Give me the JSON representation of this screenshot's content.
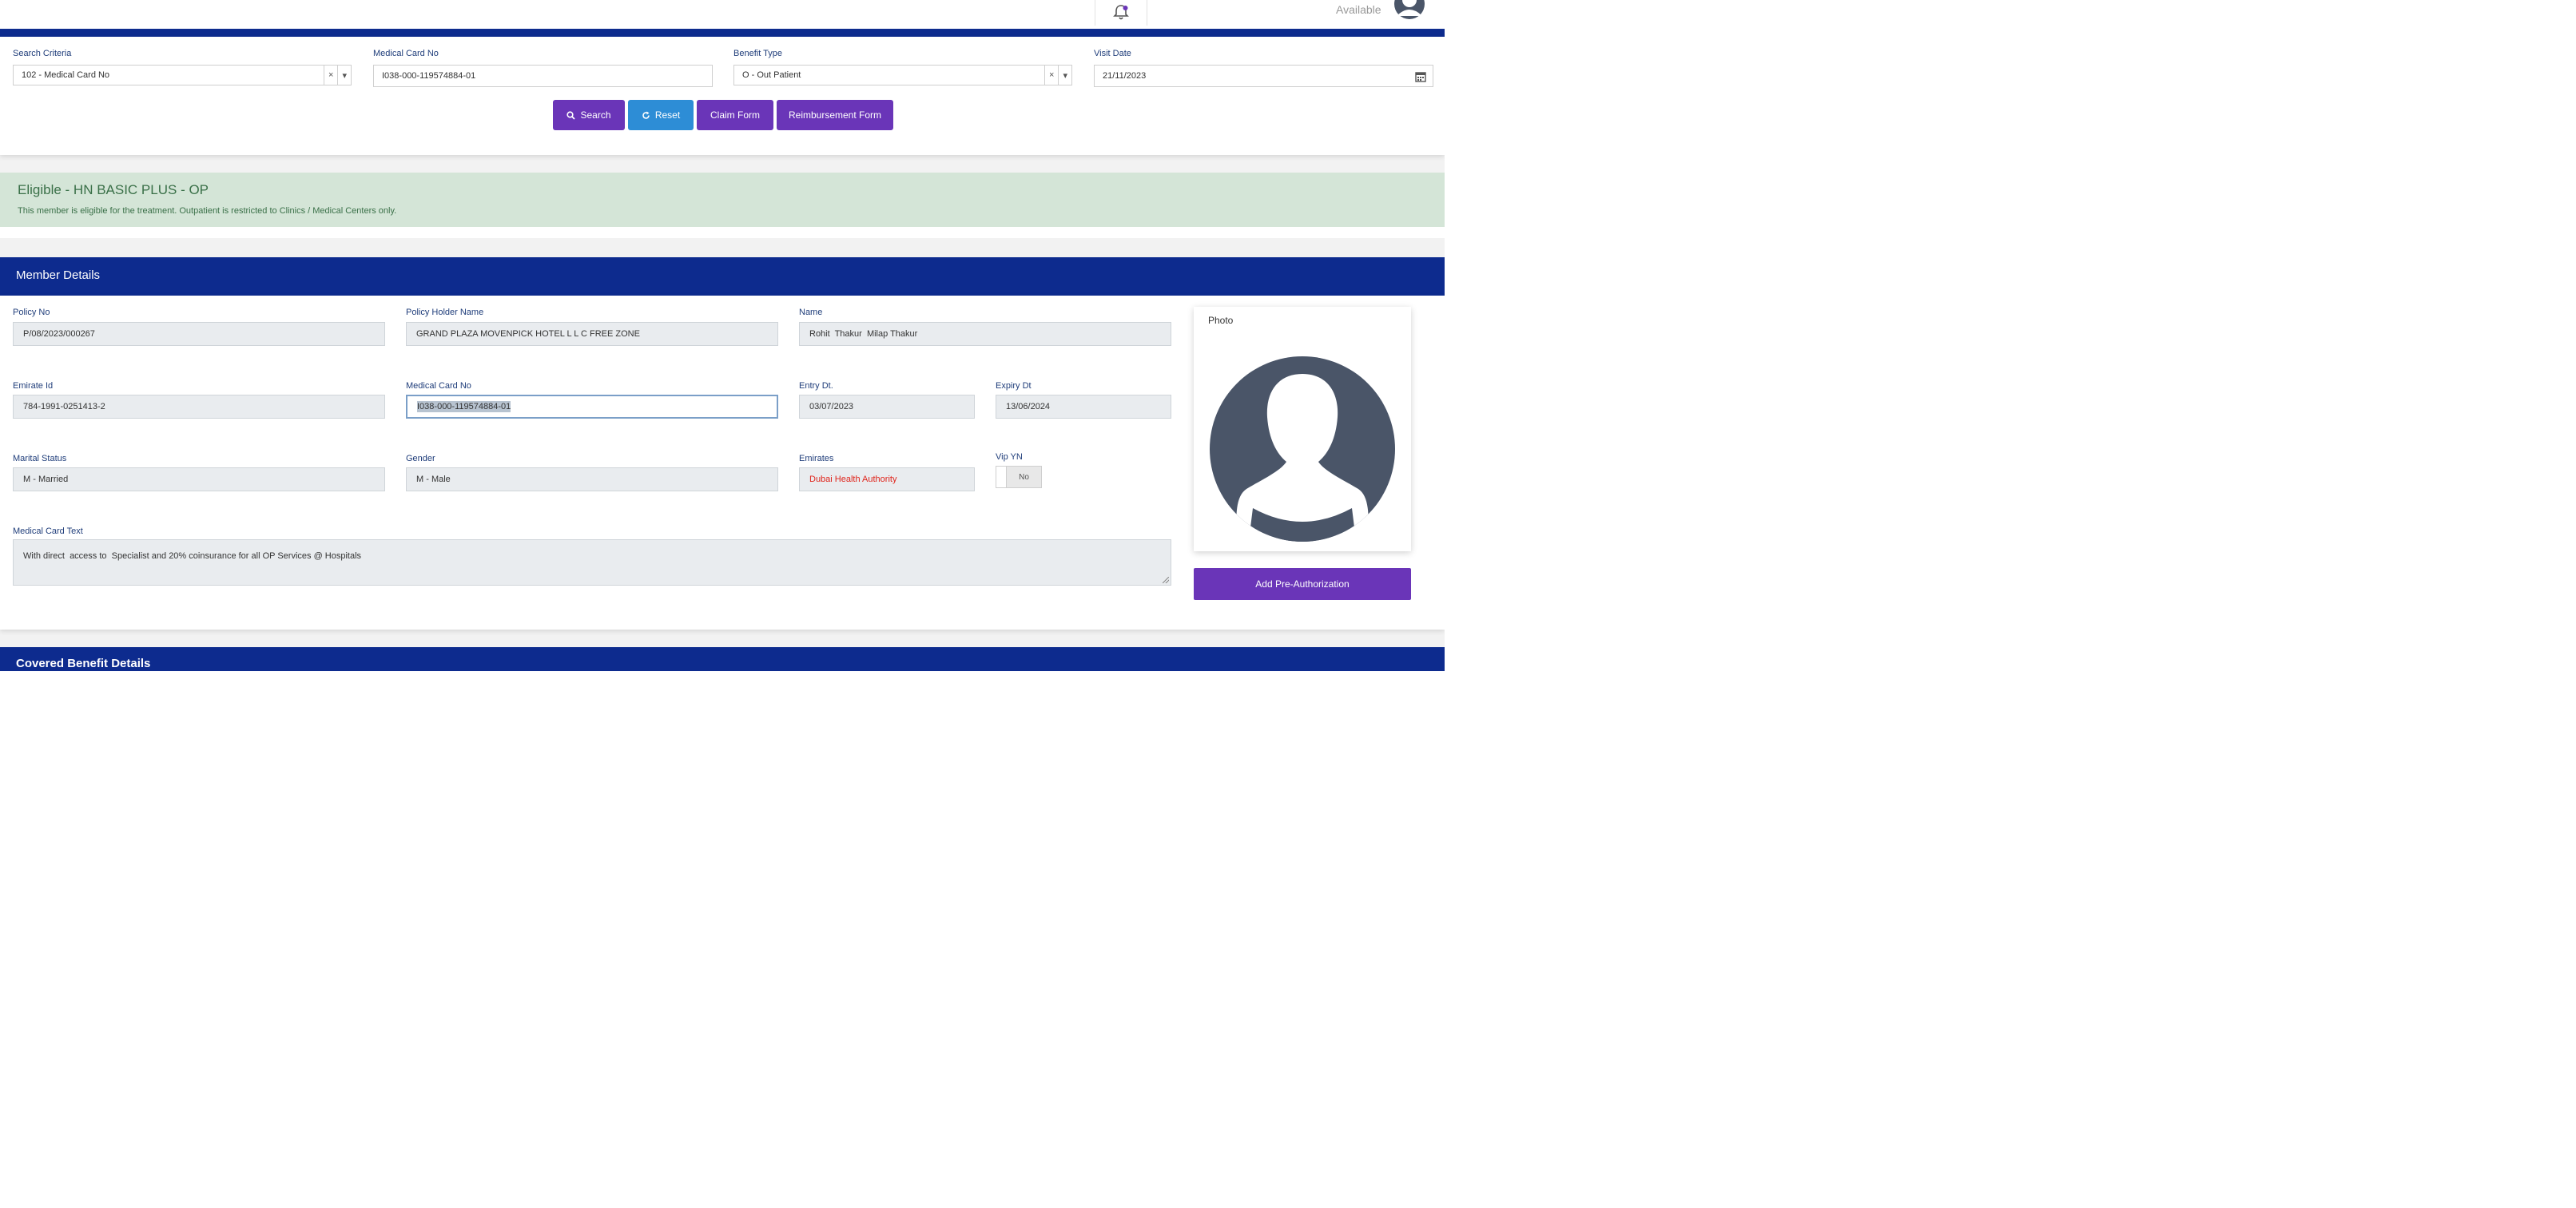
{
  "header": {
    "status": "Available",
    "icons": {
      "notifications": "bell-icon",
      "user": "user-avatar-icon"
    }
  },
  "search": {
    "criteria_label": "Search Criteria",
    "criteria_value": "102 - Medical Card No",
    "card_label": "Medical Card No",
    "card_value": "I038-000-119574884-01",
    "benefit_label": "Benefit Type",
    "benefit_value": "O - Out Patient",
    "visit_label": "Visit Date",
    "visit_value": "21/11/2023",
    "clear_glyph": "×",
    "dropdown_glyph": "▾",
    "buttons": {
      "search": "Search",
      "reset": "Reset",
      "claim": "Claim Form",
      "reimbursement": "Reimbursement Form"
    }
  },
  "eligibility": {
    "title": "Eligible - HN BASIC PLUS - OP",
    "message": "This member is eligible for the treatment. Outpatient is restricted to Clinics / Medical Centers only."
  },
  "member": {
    "section_title": "Member Details",
    "fields": {
      "policy_no": {
        "label": "Policy No",
        "value": "P/08/2023/000267"
      },
      "policy_holder": {
        "label": "Policy Holder Name",
        "value": "GRAND PLAZA MOVENPICK HOTEL L L C FREE ZONE"
      },
      "name": {
        "label": "Name",
        "value": "Rohit  Thakur  Milap Thakur"
      },
      "emirate_id": {
        "label": "Emirate Id",
        "value": "784-1991-0251413-2"
      },
      "medical_card": {
        "label": "Medical Card No",
        "value": "I038-000-119574884-01"
      },
      "entry_dt": {
        "label": "Entry Dt.",
        "value": "03/07/2023"
      },
      "expiry_dt": {
        "label": "Expiry Dt",
        "value": "13/06/2024"
      },
      "marital": {
        "label": "Marital Status",
        "value": "M - Married"
      },
      "gender": {
        "label": "Gender",
        "value": "M - Male"
      },
      "emirates": {
        "label": "Emirates",
        "value": "Dubai Health Authority"
      },
      "vip": {
        "label": "Vip YN",
        "value": "No"
      },
      "card_text": {
        "label": "Medical Card Text",
        "value": "With direct  access to  Specialist and 20% coinsurance for all OP Services @ Hospitals"
      }
    },
    "photo_label": "Photo",
    "add_button": "Add Pre-Authorization",
    "colors": {
      "header_blue": "#0d2b8e",
      "button_purple": "#6a35b8",
      "button_blue": "#2d8dd6",
      "alert_green": "#d4e5d7",
      "error_red": "#e0241b"
    }
  },
  "covered": {
    "section_title": "Covered Benefit Details"
  }
}
